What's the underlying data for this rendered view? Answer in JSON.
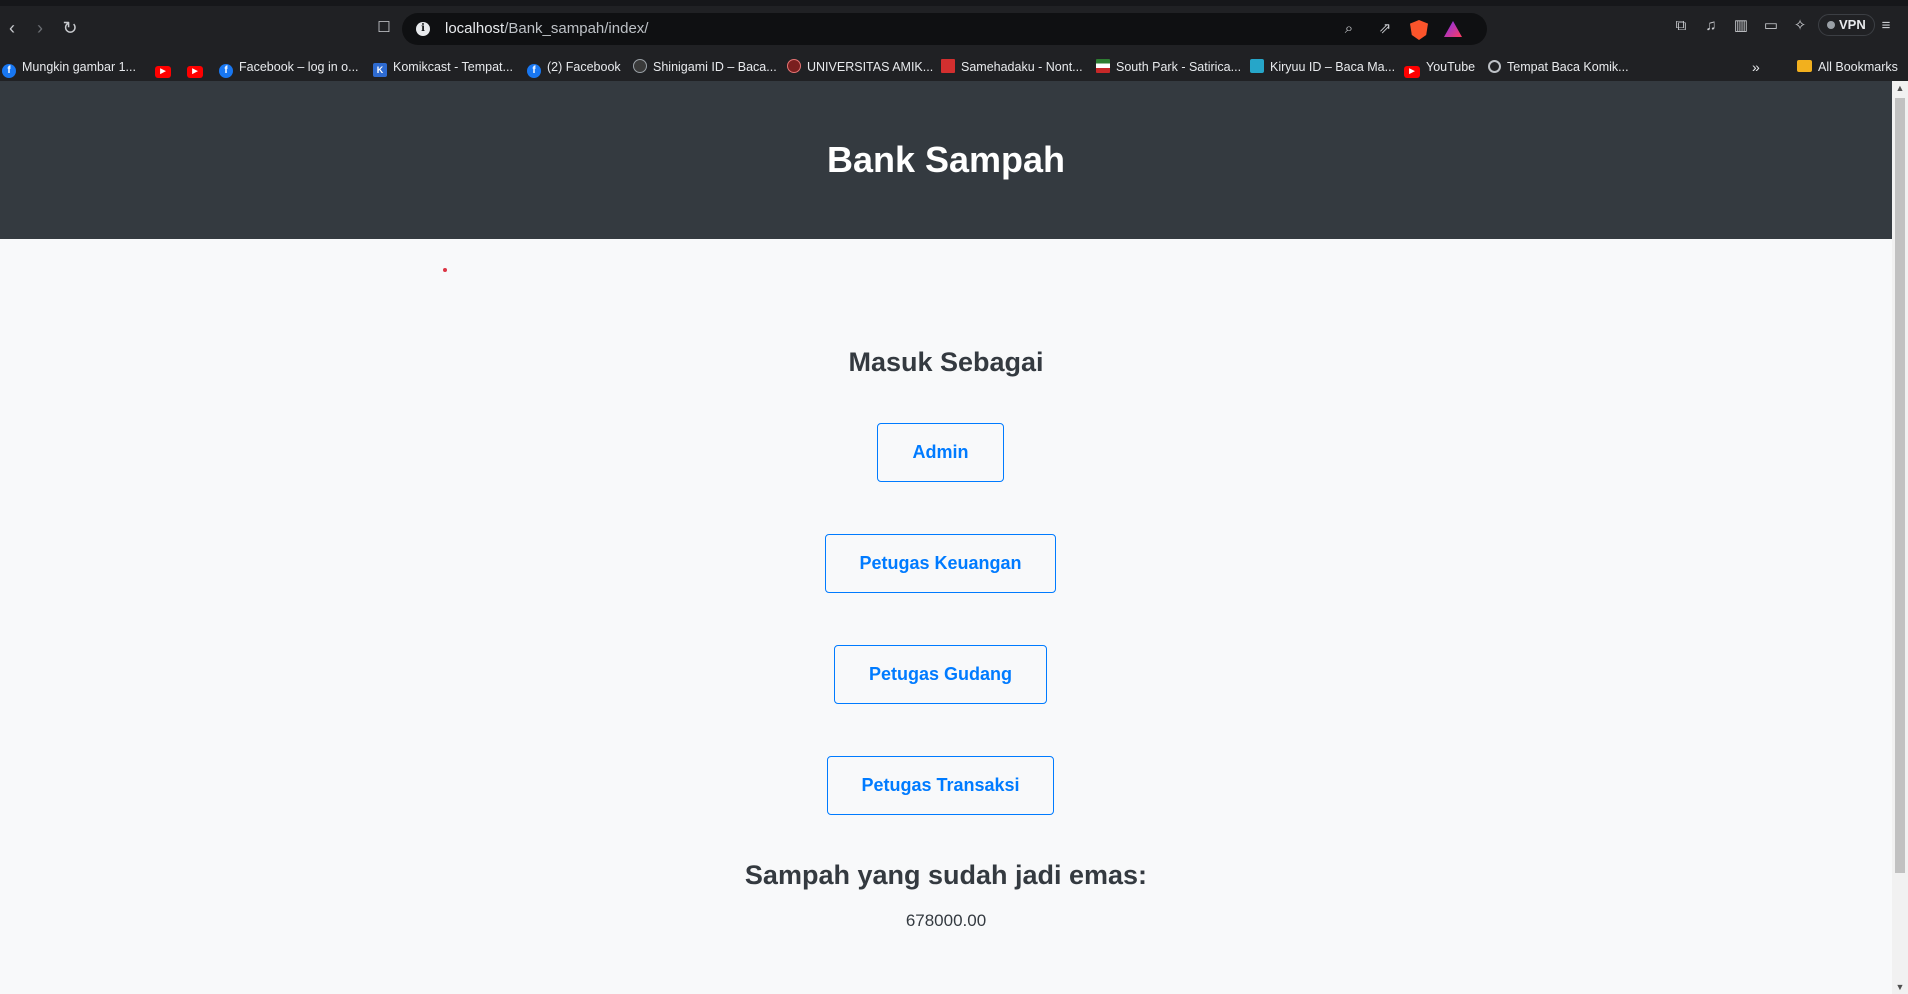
{
  "browser": {
    "url_host": "localhost",
    "url_path": "/Bank_sampah/index/",
    "vpn_label": "VPN"
  },
  "bookmarks": [
    {
      "label": "Mungkin gambar 1...",
      "icon": "facebook-icon"
    },
    {
      "label": "",
      "icon": "youtube-icon"
    },
    {
      "label": "",
      "icon": "youtube-icon"
    },
    {
      "label": "Facebook – log in o...",
      "icon": "facebook-icon"
    },
    {
      "label": "Komikcast - Tempat...",
      "icon": "komikcast-icon"
    },
    {
      "label": "(2) Facebook",
      "icon": "facebook-icon"
    },
    {
      "label": "Shinigami ID – Baca...",
      "icon": "shinigami-icon"
    },
    {
      "label": "UNIVERSITAS AMIK...",
      "icon": "university-icon"
    },
    {
      "label": "Samehadaku - Nont...",
      "icon": "samehadaku-icon"
    },
    {
      "label": "South Park - Satirica...",
      "icon": "southpark-icon"
    },
    {
      "label": "Kiryuu ID – Baca Ma...",
      "icon": "kiryuu-icon"
    },
    {
      "label": "YouTube",
      "icon": "youtube-icon"
    },
    {
      "label": "Tempat Baca Komik...",
      "icon": "globe-icon"
    }
  ],
  "all_bookmarks_label": "All Bookmarks",
  "page": {
    "title": "Bank Sampah",
    "login_heading": "Masuk Sebagai",
    "buttons": {
      "admin": "Admin",
      "keuangan": "Petugas Keuangan",
      "gudang": "Petugas Gudang",
      "transaksi": "Petugas Transaksi"
    },
    "gold_heading": "Sampah yang sudah jadi emas:",
    "gold_amount": "678000.00"
  },
  "colors": {
    "header_bg": "#343a40",
    "button_primary": "#007bff",
    "page_bg": "#f8f9fa"
  }
}
